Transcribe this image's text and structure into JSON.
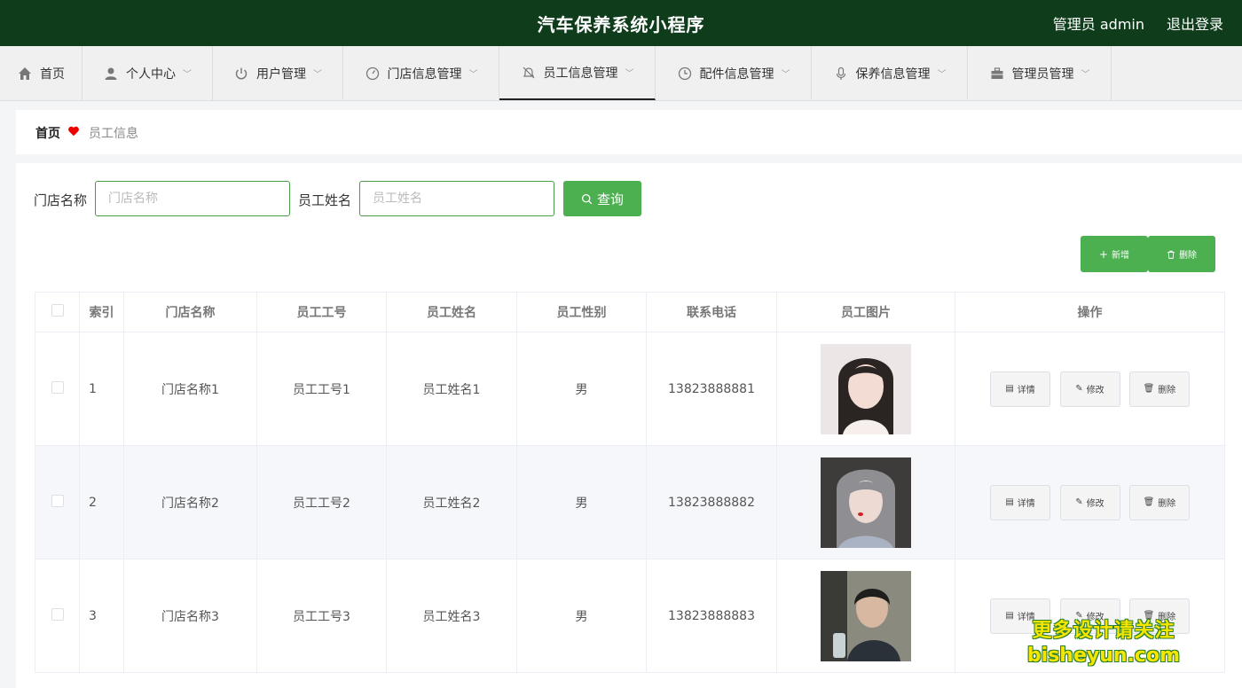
{
  "app": {
    "title": "汽车保养系统小程序",
    "admin_label": "管理员 admin",
    "logout_label": "退出登录",
    "colors": {
      "topbar": "#0f3d1c",
      "accent": "#4caf50"
    }
  },
  "nav": [
    {
      "label": "首页",
      "icon": "home-icon",
      "dropdown": false
    },
    {
      "label": "个人中心",
      "icon": "user-icon",
      "dropdown": true
    },
    {
      "label": "用户管理",
      "icon": "power-icon",
      "dropdown": true
    },
    {
      "label": "门店信息管理",
      "icon": "gauge-icon",
      "dropdown": true
    },
    {
      "label": "员工信息管理",
      "icon": "bell-off-icon",
      "dropdown": true,
      "active": true
    },
    {
      "label": "配件信息管理",
      "icon": "clock-icon",
      "dropdown": true
    },
    {
      "label": "保养信息管理",
      "icon": "microphone-icon",
      "dropdown": true
    },
    {
      "label": "管理员管理",
      "icon": "briefcase-icon",
      "dropdown": true
    }
  ],
  "breadcrumb": {
    "home": "首页",
    "current": "员工信息"
  },
  "search": {
    "store_label": "门店名称",
    "store_placeholder": "门店名称",
    "name_label": "员工姓名",
    "name_placeholder": "员工姓名",
    "query_label": "查询"
  },
  "actions": {
    "add_label": "新增",
    "delete_label": "删除"
  },
  "table": {
    "headers": [
      "索引",
      "门店名称",
      "员工工号",
      "员工姓名",
      "员工性别",
      "联系电话",
      "员工图片",
      "操作"
    ],
    "op_labels": {
      "detail": "详情",
      "edit": "修改",
      "delete": "删除"
    },
    "rows": [
      {
        "index": "1",
        "store": "门店名称1",
        "emp_no": "员工工号1",
        "name": "员工姓名1",
        "gender": "男",
        "phone": "13823888881"
      },
      {
        "index": "2",
        "store": "门店名称2",
        "emp_no": "员工工号2",
        "name": "员工姓名2",
        "gender": "男",
        "phone": "13823888882"
      },
      {
        "index": "3",
        "store": "门店名称3",
        "emp_no": "员工工号3",
        "name": "员工姓名3",
        "gender": "男",
        "phone": "13823888883"
      }
    ]
  },
  "watermark": {
    "line1": "更多设计请关注",
    "line2": "bisheyun.com"
  }
}
